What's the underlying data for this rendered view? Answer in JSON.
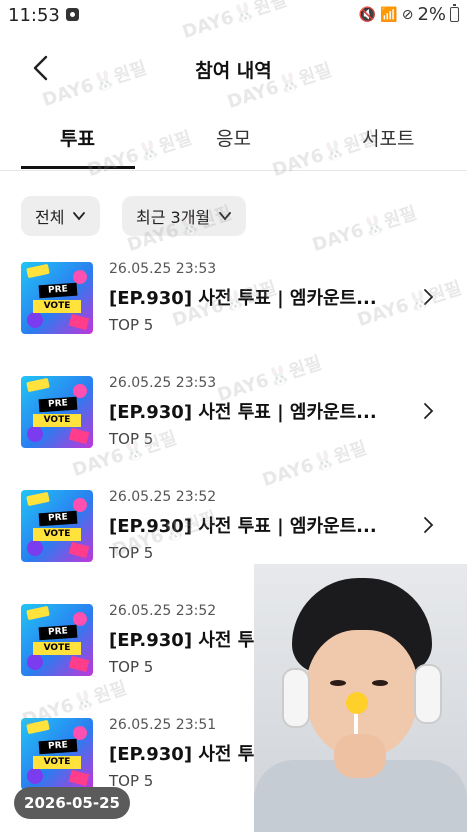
{
  "status_bar": {
    "time": "11:53",
    "battery_percent": "2%"
  },
  "header": {
    "title": "참여 내역"
  },
  "tabs": [
    {
      "label": "투표",
      "active": true
    },
    {
      "label": "응모",
      "active": false
    },
    {
      "label": "서포트",
      "active": false
    }
  ],
  "filters": {
    "type": "전체",
    "period": "최근 3개월"
  },
  "entries": [
    {
      "date": "26.05.25 23:53",
      "title": "[EP.930] 사전 투표 | 엠카운트...",
      "rank": "TOP 5",
      "thumb_text": [
        "PRE",
        "VOTE"
      ]
    },
    {
      "date": "26.05.25 23:53",
      "title": "[EP.930] 사전 투표 | 엠카운트...",
      "rank": "TOP 5",
      "thumb_text": [
        "PRE",
        "VOTE"
      ]
    },
    {
      "date": "26.05.25 23:52",
      "title": "[EP.930] 사전 투표 | 엠카운트...",
      "rank": "TOP 5",
      "thumb_text": [
        "PRE",
        "VOTE"
      ]
    },
    {
      "date": "26.05.25 23:52",
      "title": "[EP.930] 사전 투",
      "rank": "TOP 5",
      "thumb_text": [
        "PRE",
        "VOTE"
      ]
    },
    {
      "date": "26.05.25 23:51",
      "title": "[EP.930] 사전 투",
      "rank": "TOP 5",
      "thumb_text": [
        "PRE",
        "VOTE"
      ]
    }
  ],
  "watermark": "DAY6🐰원필",
  "date_badge": "2026-05-25",
  "colors": {
    "text": "#111111",
    "chip_bg": "#eeeeee",
    "badge_bg": "#5b5b5b"
  }
}
